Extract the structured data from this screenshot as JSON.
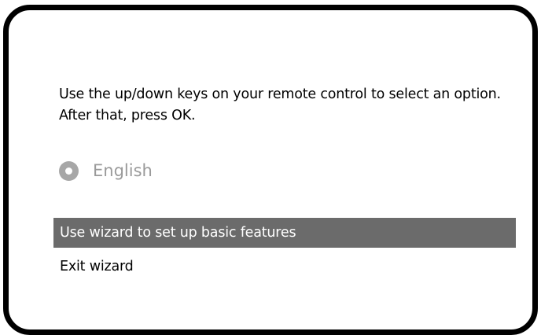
{
  "dialog": {
    "instructions": "Use the up/down keys on your remote control to select an option. After that, press OK."
  },
  "language": {
    "icon": "radio-selected-icon",
    "label": "English"
  },
  "menu": {
    "items": [
      {
        "label": "Use wizard to set up basic features",
        "selected": true
      },
      {
        "label": "Exit wizard",
        "selected": false
      }
    ]
  },
  "colors": {
    "frame_border": "#000000",
    "background": "#ffffff",
    "selection": "#6b6b6b",
    "selection_text": "#ffffff",
    "disabled_text": "#9a9a9a",
    "radio": "#a7a7a7"
  }
}
